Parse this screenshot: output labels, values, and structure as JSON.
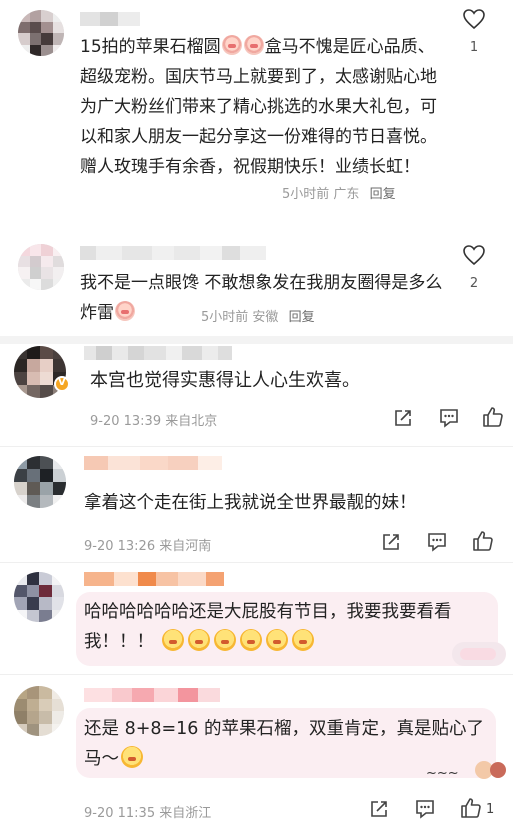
{
  "comments": [
    {
      "text": "15拍的苹果石榴圆",
      "text_after_emoji": "盒马不愧是匠心品质、超级宠粉。国庆节马上就要到了，太感谢贴心地为广大粉丝们带来了精心挑选的水果大礼包，可以和家人朋友一起分享这一份难得的节日喜悦。赠人玫瑰手有余香，祝假期快乐！业绩长虹！",
      "time": "5小时前",
      "location": "广东",
      "reply": "回复",
      "likes": "1"
    },
    {
      "text": "我不是一点眼馋 不敢想象发在我朋友圈得是多么炸雷",
      "time": "5小时前",
      "location": "安徽",
      "reply": "回复",
      "likes": "2"
    },
    {
      "text": "本宫也觉得实惠得让人心生欢喜。",
      "time": "9-20 13:39",
      "location": "来自北京"
    },
    {
      "text": "拿着这个走在街上我就说全世界最靓的妹！",
      "time": "9-20 13:26",
      "location": "来自河南"
    },
    {
      "text": "哈哈哈哈哈哈还是大屁股有节目，我要我要看看我！！！",
      "time": "",
      "location": ""
    },
    {
      "text": "还是 8+8=16 的苹果石榴，双重肯定，真是贴心了马～",
      "time": "9-20 11:35",
      "location": "来自浙江",
      "likes": "1"
    }
  ],
  "icons": {
    "heart": "heart-icon",
    "share": "share-icon",
    "comment": "comment-icon",
    "like": "thumbs-up-icon"
  },
  "colors": {
    "bubble_pink": "#fbeef2",
    "divider": "#f3f3f3",
    "meta_gray": "#9a9a9a",
    "vip_orange": "#f5a623"
  }
}
